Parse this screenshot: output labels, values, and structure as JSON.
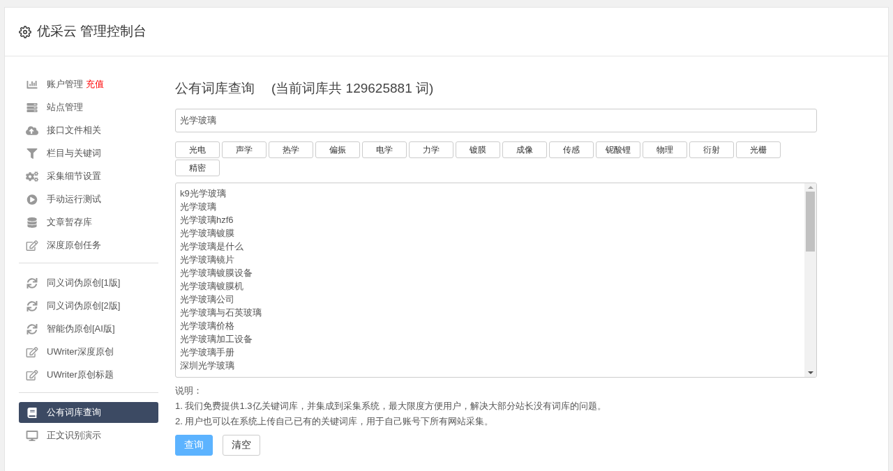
{
  "header": {
    "title": "优采云 管理控制台"
  },
  "sidebar": {
    "groups": [
      {
        "items": [
          {
            "label": "账户管理",
            "badge": "充值",
            "selected": false
          },
          {
            "label": "站点管理",
            "selected": false
          },
          {
            "label": "接口文件相关",
            "selected": false
          },
          {
            "label": "栏目与关键词",
            "selected": false
          },
          {
            "label": "采集细节设置",
            "selected": false
          },
          {
            "label": "手动运行测试",
            "selected": false
          },
          {
            "label": "文章暂存库",
            "selected": false
          },
          {
            "label": "深度原创任务",
            "selected": false
          }
        ]
      },
      {
        "items": [
          {
            "label": "同义词伪原创[1版]",
            "selected": false
          },
          {
            "label": "同义词伪原创[2版]",
            "selected": false
          },
          {
            "label": "智能伪原创[AI版]",
            "selected": false
          },
          {
            "label": "UWriter深度原创",
            "selected": false
          },
          {
            "label": "UWriter原创标题",
            "selected": false
          }
        ]
      },
      {
        "items": [
          {
            "label": "公有词库查询",
            "selected": true
          },
          {
            "label": "正文识别演示",
            "selected": false
          }
        ]
      }
    ]
  },
  "main": {
    "title": "公有词库查询",
    "subtitle": "(当前词库共 129625881 词)",
    "search": {
      "value": "光学玻璃"
    },
    "tags": [
      "光电",
      "声学",
      "热学",
      "偏振",
      "电学",
      "力学",
      "镀膜",
      "成像",
      "传感",
      "铌酸锂",
      "物理",
      "衍射",
      "光栅",
      "精密"
    ],
    "results": [
      "k9光学玻璃",
      "光学玻璃",
      "光学玻璃hzf6",
      "光学玻璃镀膜",
      "光学玻璃是什么",
      "光学玻璃镜片",
      "光学玻璃镀膜设备",
      "光学玻璃镀膜机",
      "光学玻璃公司",
      "光学玻璃与石英玻璃",
      "光学玻璃价格",
      "光学玻璃加工设备",
      "光学玻璃手册",
      "深圳光学玻璃"
    ],
    "notes": {
      "heading": "说明：",
      "lines": [
        "1. 我们免费提供1.3亿关键词库，并集成到采集系统，最大限度方便用户，解决大部分站长没有词库的问题。",
        "2. 用户也可以在系统上传自己已有的关键词库，用于自己账号下所有网站采集。"
      ]
    },
    "buttons": [
      {
        "label": "查询",
        "kind": "primary"
      },
      {
        "label": "清空",
        "kind": "default"
      }
    ]
  }
}
